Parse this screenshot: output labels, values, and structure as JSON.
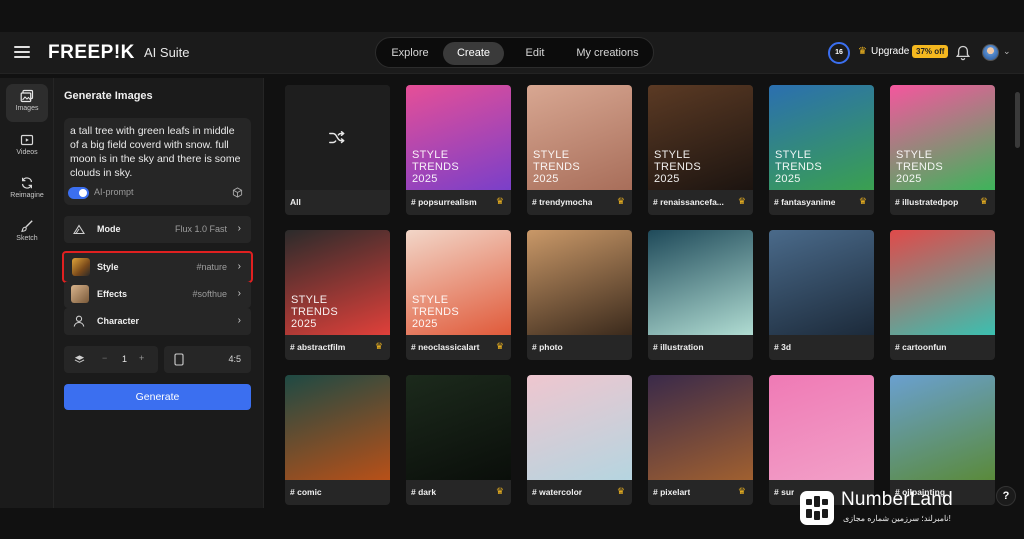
{
  "header": {
    "logo": "FREEP!K",
    "suite": "AI Suite",
    "tabs": [
      {
        "label": "Explore",
        "active": false
      },
      {
        "label": "Create",
        "active": true
      },
      {
        "label": "Edit",
        "active": false
      },
      {
        "label": "My creations",
        "active": false
      }
    ],
    "credits": "16",
    "upgrade_label": "Upgrade",
    "discount_badge": "37% off"
  },
  "rail": {
    "items": [
      {
        "label": "Images",
        "icon": "image-icon",
        "active": true
      },
      {
        "label": "Videos",
        "icon": "video-icon",
        "active": false
      },
      {
        "label": "Reimagine",
        "icon": "reimagine-icon",
        "active": false
      },
      {
        "label": "Sketch",
        "icon": "brush-icon",
        "active": false
      }
    ]
  },
  "panel": {
    "title": "Generate Images",
    "prompt": "a tall tree with green leafs in middle of a big field coverd with snow. full moon is in the sky and there is some clouds in sky.",
    "ai_prompt_label": "AI-prompt",
    "ai_prompt_enabled": true,
    "rows": [
      {
        "label": "Mode",
        "value": "Flux 1.0 Fast",
        "icon": "mode-icon"
      },
      {
        "label": "Style",
        "value": "#nature",
        "icon": "style-thumbnail",
        "selected": true
      },
      {
        "label": "Effects",
        "value": "#softhue",
        "icon": "effects-thumbnail"
      },
      {
        "label": "Character",
        "value": "",
        "icon": "character-icon"
      }
    ],
    "count": "1",
    "count_minus": "−",
    "count_plus": "+",
    "aspect_ratio": "4:5",
    "generate_label": "Generate"
  },
  "grid": {
    "trend_text": "STYLE TRENDS 2025",
    "cards": [
      {
        "label": "All",
        "crown": false,
        "trend": false,
        "colors": [
          "#1e1e1e",
          "#1e1e1e"
        ]
      },
      {
        "label": "# popsurrealism",
        "crown": true,
        "trend": true,
        "colors": [
          "#e64f97",
          "#7a3fc9"
        ]
      },
      {
        "label": "# trendymocha",
        "crown": true,
        "trend": true,
        "colors": [
          "#d8a792",
          "#a86e5a"
        ]
      },
      {
        "label": "# renaissancefa...",
        "crown": true,
        "trend": true,
        "colors": [
          "#5b3a24",
          "#1c1410"
        ]
      },
      {
        "label": "# fantasyanime",
        "crown": true,
        "trend": true,
        "colors": [
          "#2b6fb0",
          "#3aa050"
        ]
      },
      {
        "label": "# illustratedpop",
        "crown": true,
        "trend": true,
        "colors": [
          "#f5569e",
          "#3db45a"
        ]
      },
      {
        "label": "# abstractfilm",
        "crown": true,
        "trend": true,
        "colors": [
          "#2b2b2b",
          "#e0403a"
        ]
      },
      {
        "label": "# neoclassicalart",
        "crown": true,
        "trend": true,
        "colors": [
          "#f2d6c8",
          "#e05a3a"
        ]
      },
      {
        "label": "# photo",
        "crown": false,
        "trend": false,
        "colors": [
          "#c99868",
          "#3b2a1c"
        ]
      },
      {
        "label": "# illustration",
        "crown": false,
        "trend": false,
        "colors": [
          "#1f4a5a",
          "#b0dcd2"
        ]
      },
      {
        "label": "# 3d",
        "crown": false,
        "trend": false,
        "colors": [
          "#4a6a8a",
          "#1c2a3a"
        ]
      },
      {
        "label": "# cartoonfun",
        "crown": false,
        "trend": false,
        "colors": [
          "#e04a4a",
          "#3bc0b0"
        ]
      },
      {
        "label": "# comic",
        "crown": false,
        "trend": false,
        "colors": [
          "#1e4a44",
          "#b85018"
        ]
      },
      {
        "label": "# dark",
        "crown": true,
        "trend": false,
        "colors": [
          "#1c2a1c",
          "#0a0e0a"
        ]
      },
      {
        "label": "# watercolor",
        "crown": true,
        "trend": false,
        "colors": [
          "#efc6cf",
          "#b5d5e0"
        ]
      },
      {
        "label": "# pixelart",
        "crown": true,
        "trend": false,
        "colors": [
          "#3a2a4a",
          "#a06030"
        ]
      },
      {
        "label": "# sur",
        "crown": false,
        "trend": false,
        "colors": [
          "#ef7ab5",
          "#f2a0c8"
        ]
      },
      {
        "label": "# oilpainting",
        "crown": false,
        "trend": false,
        "colors": [
          "#6aa0d0",
          "#5a8a3a"
        ]
      }
    ]
  },
  "watermark": {
    "title": "NumberLand",
    "subtitle": "نامبرلند؛ سرزمین شماره مجازی!"
  },
  "help_label": "?"
}
